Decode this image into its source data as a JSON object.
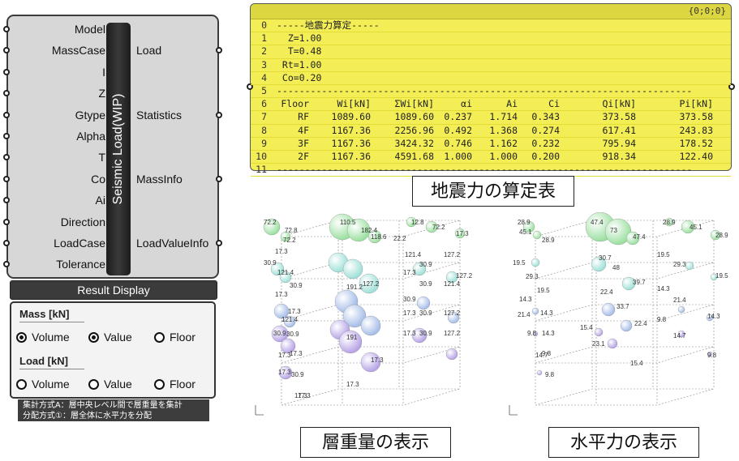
{
  "component": {
    "title": "Seismic Load(WIP)",
    "inputs": [
      "Model",
      "MassCase",
      "I",
      "Z",
      "Gtype",
      "Alpha",
      "T",
      "Co",
      "Ai",
      "Direction",
      "LoadCase",
      "Tolerance"
    ],
    "outputs": [
      "Load",
      "Statistics",
      "MassInfo",
      "LoadValueInfo"
    ],
    "result_button": "Result Display",
    "mass_section": {
      "title": "Mass [kN]",
      "options": [
        {
          "label": "Volume",
          "selected": true
        },
        {
          "label": "Value",
          "selected": true
        },
        {
          "label": "Floor",
          "selected": false
        }
      ]
    },
    "load_section": {
      "title": "Load [kN]",
      "options": [
        {
          "label": "Volume",
          "selected": false
        },
        {
          "label": "Value",
          "selected": false
        },
        {
          "label": "Floor",
          "selected": false
        }
      ]
    },
    "note_lines": [
      "集計方式A：層中央レベル間で層重量を集計",
      "分配方式①：層全体に水平力を分配"
    ]
  },
  "panel": {
    "path_id": "{0;0;0}",
    "header_rows": [
      {
        "index": "0",
        "text": "-----地震力算定-----"
      },
      {
        "index": "1",
        "text": "  Z=1.00"
      },
      {
        "index": "2",
        "text": "  T=0.48"
      },
      {
        "index": "3",
        "text": " Rt=1.00"
      },
      {
        "index": "4",
        "text": " Co=0.20"
      },
      {
        "index": "5",
        "text": "--------------------------------------------------------------------------"
      }
    ],
    "table_index": "6",
    "columns": [
      "Floor",
      "Wi[kN]",
      "ΣWi[kN]",
      "αi",
      "Ai",
      "Ci",
      "Qi[kN]",
      "Pi[kN]"
    ],
    "rows": [
      {
        "index": "7",
        "cells": [
          "RF",
          "1089.60",
          "1089.60",
          "0.237",
          "1.714",
          "0.343",
          "373.58",
          "373.58"
        ]
      },
      {
        "index": "8",
        "cells": [
          "4F",
          "1167.36",
          "2256.96",
          "0.492",
          "1.368",
          "0.274",
          "617.41",
          "243.83"
        ]
      },
      {
        "index": "9",
        "cells": [
          "3F",
          "1167.36",
          "3424.32",
          "0.746",
          "1.162",
          "0.232",
          "795.94",
          "178.52"
        ]
      },
      {
        "index": "10",
        "cells": [
          "2F",
          "1167.36",
          "4591.68",
          "1.000",
          "1.000",
          "0.200",
          "918.34",
          "122.40"
        ]
      }
    ],
    "footer_row": {
      "index": "11",
      "text": "--------------------------------------------------------------------------"
    }
  },
  "captions": {
    "table": "地震力の算定表",
    "mass": "層重量の表示",
    "load": "水平力の表示"
  },
  "viz_mass": {
    "labels": [
      "72.2",
      "72.8",
      "72.2",
      "17.3",
      "30.9",
      "121.4",
      "30.9",
      "17.3",
      "17.3",
      "30.9",
      "121.4",
      "30.9",
      "17.3",
      "17.3",
      "30.9",
      "17.3",
      "17.3",
      "17.3",
      "110.5",
      "182.4",
      "118.6",
      "22.2",
      "12.8",
      "72.2",
      "17.3",
      "121.4",
      "30.9",
      "127.2",
      "127.2",
      "17.3",
      "30.9",
      "121.4",
      "30.9",
      "191.2",
      "127.2",
      "17.3",
      "30.9",
      "127.2",
      "191",
      "17.3",
      "30.9",
      "127.2",
      "17.3",
      "17.3"
    ]
  },
  "viz_load": {
    "labels": [
      "28.9",
      "45.1",
      "28.9",
      "19.5",
      "29.3",
      "19.5",
      "14.3",
      "21.4",
      "14.3",
      "9.8",
      "14.3",
      "9.8",
      "14.7",
      "9.8",
      "47.4",
      "73",
      "47.4",
      "30.7",
      "48",
      "39.7",
      "22.4",
      "33.7",
      "22.4",
      "15.4",
      "23.1",
      "15.4",
      "28.9",
      "45.1",
      "28.9",
      "19.5",
      "29.3",
      "19.5",
      "14.3",
      "21.4",
      "14.3",
      "9.8",
      "14.7",
      "9.8"
    ]
  }
}
